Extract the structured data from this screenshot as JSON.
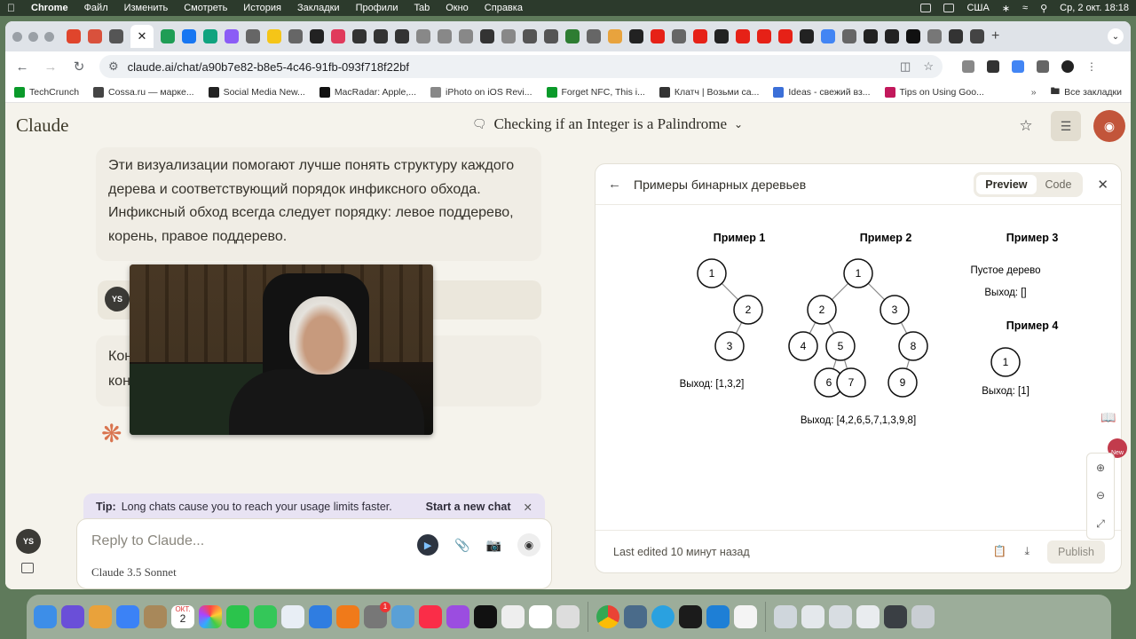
{
  "menubar": {
    "app_name": "Chrome",
    "items": [
      "Файл",
      "Изменить",
      "Смотреть",
      "История",
      "Закладки",
      "Профили",
      "Tab",
      "Окно",
      "Справка"
    ],
    "input_source": "США",
    "datetime": "Ср, 2 окт.  18:18"
  },
  "browser": {
    "url": "claude.ai/chat/a90b7e82-b8e5-4c46-91fb-093f718f22bf",
    "bookmarks": [
      {
        "label": "TechCrunch",
        "color": "#0a9a2a"
      },
      {
        "label": "Cossa.ru — марке...",
        "color": "#444444"
      },
      {
        "label": "Social Media New...",
        "color": "#222222"
      },
      {
        "label": "MacRadar: Apple,...",
        "color": "#111111"
      },
      {
        "label": "iPhoto on iOS Revi...",
        "color": "#888888"
      },
      {
        "label": "Forget NFC, This i...",
        "color": "#0a9a2a"
      },
      {
        "label": "Клатч | Возьми са...",
        "color": "#333333"
      },
      {
        "label": "Ideas - свежий вз...",
        "color": "#3b6fd8"
      },
      {
        "label": "Tips on Using Goo...",
        "color": "#c2185b"
      }
    ],
    "all_bookmarks": "Все закладки"
  },
  "claude": {
    "logo": "Claude",
    "chat_title": "Checking if an Integer is a Palindrome",
    "assistant_message": "Эти визуализации помогают лучше понять структуру каждого дерева и соответствующий порядок инфиксного обхода. Инфиксный обход всегда следует порядку: левое поддерево, корень, правое поддерево.",
    "user_initials": "YS",
    "partial_message_line1": "Кон",
    "partial_message_line2": "кон",
    "tip_label": "Tip:",
    "tip_text": "Long chats cause you to reach your usage limits faster.",
    "tip_link": "Start a new chat",
    "composer_placeholder": "Reply to Claude...",
    "model_name": "Claude 3.5 Sonnet"
  },
  "artifact": {
    "title": "Примеры бинарных деревьев",
    "tab_preview": "Preview",
    "tab_code": "Code",
    "last_edited": "Last edited 10 минут назад",
    "publish_label": "Publish",
    "examples": [
      {
        "title": "Пример 1",
        "output": "Выход: [1,3,2]",
        "nodes": [
          "1",
          "2",
          "3"
        ]
      },
      {
        "title": "Пример 2",
        "output": "Выход: [4,2,6,5,7,1,3,9,8]",
        "nodes": [
          "1",
          "2",
          "3",
          "4",
          "5",
          "8",
          "6",
          "7",
          "9"
        ]
      },
      {
        "title": "Пример 3",
        "empty_label": "Пустое дерево",
        "output": "Выход: []"
      },
      {
        "title": "Пример 4",
        "output": "Выход: [1]",
        "nodes": [
          "1"
        ]
      }
    ]
  },
  "misc": {
    "new_badge": "New",
    "calendar_month": "ОКТ.",
    "calendar_day": "2",
    "notification_count": "1"
  },
  "colors": {
    "accent": "#c2553a",
    "tip_bg": "#e8e3f3",
    "page_bg": "#f5f3ec"
  }
}
